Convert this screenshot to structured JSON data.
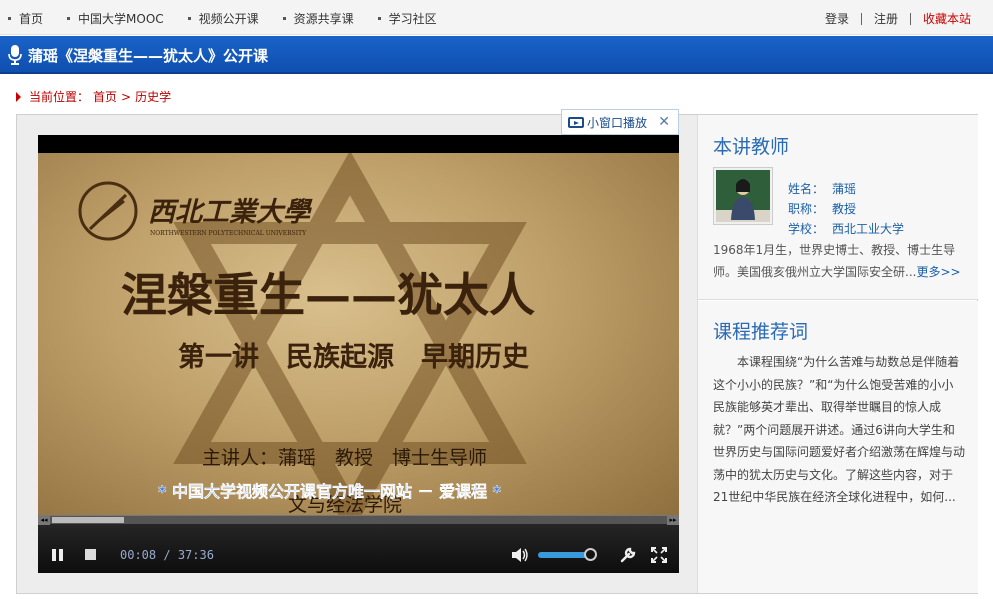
{
  "topnav": {
    "items": [
      "首页",
      "中国大学MOOC",
      "视频公开课",
      "资源共享课",
      "学习社区"
    ],
    "login": "登录",
    "register": "注册",
    "favorite": "收藏本站"
  },
  "header": {
    "title": "蒲瑶《涅槃重生——犹太人》公开课"
  },
  "breadcrumb": {
    "label": "当前位置：",
    "home": "首页",
    "sep": ">",
    "current": "历史学"
  },
  "mini_player": {
    "label": "小窗口播放",
    "close": "✕"
  },
  "video": {
    "school_name": "西北工業大學",
    "school_en": "NORTHWESTERN POLYTECHNICAL UNIVERSITY",
    "course_title": "涅槃重生——犹太人",
    "lecture": "第一讲　民族起源　早期历史",
    "lecturer": "主讲人：蒲瑶　教授　博士生导师",
    "dept": "文与经法学院",
    "watermark": "* 中国大学视频公开课官方唯一网站 － 爱课程 *"
  },
  "controls": {
    "time_current": "00:08",
    "time_sep": "/",
    "time_total": "37:36",
    "progress_fraction": 0.117,
    "volume_fraction": 0.9,
    "arrow_left": "◂◂",
    "arrow_right": "▸▸"
  },
  "teacher": {
    "heading": "本讲教师",
    "name_key": "姓名：",
    "name": "蒲瑶",
    "title_key": "职称：",
    "title": "教授",
    "school_key": "学校：",
    "school": "西北工业大学",
    "bio": "1968年1月生，世界史博士、教授、博士生导师。美国俄亥俄州立大学国际安全研...",
    "more": "更多>>"
  },
  "recommend": {
    "heading": "课程推荐词",
    "text": "本课程围绕“为什么苦难与劫数总是伴随着这个小小的民族？”和“为什么饱受苦难的小小民族能够英才辈出、取得举世瞩目的惊人成就？”两个问题展开讲述。通过6讲向大学生和世界历史与国际问题爱好者介绍激荡在辉煌与动荡中的犹太历史与文化。了解这些内容，对于21世纪中华民族在经济全球化进程中，如何..."
  },
  "colors": {
    "accent": "#1a5fc0",
    "link": "#1b5fa8",
    "fav": "#cc0000",
    "crumb": "#b00000"
  }
}
